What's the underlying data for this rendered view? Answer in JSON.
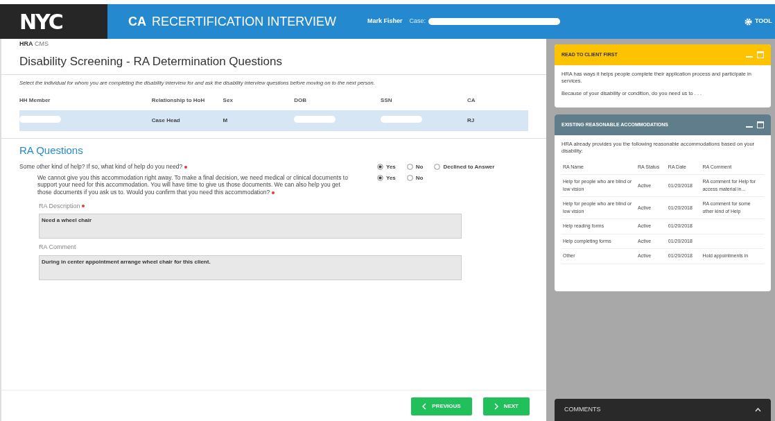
{
  "header": {
    "logo": "NYC",
    "program": "CA",
    "title": "RECERTIFICATION INTERVIEW",
    "user": "Mark Fisher",
    "case_label": "Case:",
    "tools": "TOOL"
  },
  "breadcrumb": {
    "org": "HRA",
    "app": "CMS"
  },
  "page_title": "Disability Screening - RA Determination Questions",
  "instruction": "Select the individual for whom you are completing the disability interview for and ask the disability interview questions before moving on to the next person.",
  "members": {
    "columns": [
      "HH Member",
      "Relationship to HoH",
      "Sex",
      "DOB",
      "SSN",
      "CA"
    ],
    "rows": [
      {
        "selected": true,
        "cells": [
          null,
          "Case Head",
          "M",
          null,
          null,
          "RJ"
        ]
      }
    ]
  },
  "section_title": "RA Questions",
  "questions": [
    {
      "text": "Some other kind of help?  If so, what kind of help do you need?",
      "required": true,
      "indent": false,
      "options": [
        {
          "label": "Yes",
          "selected": true
        },
        {
          "label": "No",
          "selected": false
        },
        {
          "label": "Declined to Answer",
          "selected": false
        }
      ]
    },
    {
      "text": "We cannot give you this accommodation right away. To make a final decision, we need medical or clinical documents to support your need for this accommodation. You will have time to give us those documents.  We can also help you get those documents if you ask us to.  Would you confirm that you need this accommodation?",
      "required": true,
      "indent": true,
      "options": [
        {
          "label": "Yes",
          "selected": true
        },
        {
          "label": "No",
          "selected": false
        }
      ]
    }
  ],
  "fields": [
    {
      "label": "RA Description",
      "required": true,
      "value": "Need a wheel chair"
    },
    {
      "label": "RA Comment",
      "required": false,
      "value": "During in center appointment arrange wheel chair for this client."
    }
  ],
  "buttons": {
    "previous": "PREVIOUS",
    "next": "NEXT"
  },
  "panels": [
    {
      "kind": "notice",
      "title": "READ TO CLIENT FIRST",
      "color": "#fdc300",
      "paragraphs": [
        "HRA has ways it helps people complete their application process and participate in services.",
        "Because of your disability or condition, do you need us to . . ."
      ]
    },
    {
      "kind": "table",
      "title": "EXISTING REASONABLE ACCOMMODATIONS",
      "color": "#607d8b",
      "paragraphs": [
        "HRA already provides you the following reasonable accommodations based on your disability:"
      ],
      "columns": [
        "RA Name",
        "RA Status",
        "RA Date",
        "RA Comment"
      ],
      "rows": [
        [
          "Help for people who are blind or low vision",
          "Active",
          "01/20/2018",
          "RA comment for Help for access material in..."
        ],
        [
          "Help for people who are blind or low vision",
          "Active",
          "01/20/2018",
          "RA comment for some other kind of Help"
        ],
        [
          "Help reading forms",
          "Active",
          "01/20/2018",
          ""
        ],
        [
          "Help completing forms",
          "Active",
          "01/20/2018",
          ""
        ],
        [
          "Other",
          "Active",
          "01/20/2018",
          "Hold appointments in"
        ]
      ]
    }
  ],
  "comments": {
    "title": "COMMENTS",
    "expanded": false
  }
}
